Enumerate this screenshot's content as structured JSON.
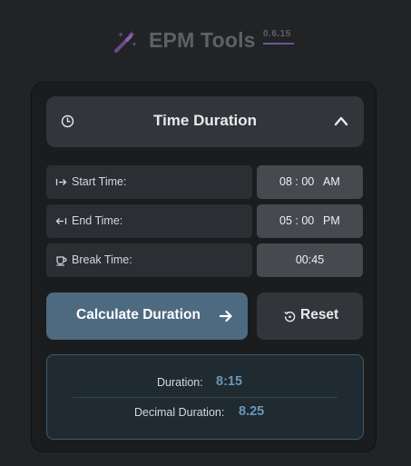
{
  "header": {
    "app_title": "EPM Tools",
    "version": "0.6.15",
    "logo_icon": "magic-wand-icon"
  },
  "section": {
    "title": "Time Duration",
    "icon": "clock-icon",
    "toggle_icon": "chevron-up-icon",
    "expanded": true
  },
  "fields": {
    "start": {
      "label": "Start Time:",
      "icon": "arrow-right-to-line-icon",
      "time": "08 : 00",
      "period": "AM"
    },
    "end": {
      "label": "End Time:",
      "icon": "arrow-left-from-line-icon",
      "time": "05 : 00",
      "period": "PM"
    },
    "break": {
      "label": "Break Time:",
      "icon": "coffee-cup-icon",
      "value": "00:45"
    }
  },
  "actions": {
    "calculate_label": "Calculate Duration",
    "calculate_icon": "arrow-right-icon",
    "reset_label": "Reset",
    "reset_icon": "reset-icon"
  },
  "results": {
    "duration_label": "Duration:",
    "duration_value": "8:15",
    "decimal_label": "Decimal Duration:",
    "decimal_value": "8.25"
  },
  "colors": {
    "background": "#222325",
    "panel": "#1b1c1e",
    "primary_button": "#4e6a81",
    "accent_value": "#6a98b8",
    "results_border": "#3f5b6d"
  }
}
